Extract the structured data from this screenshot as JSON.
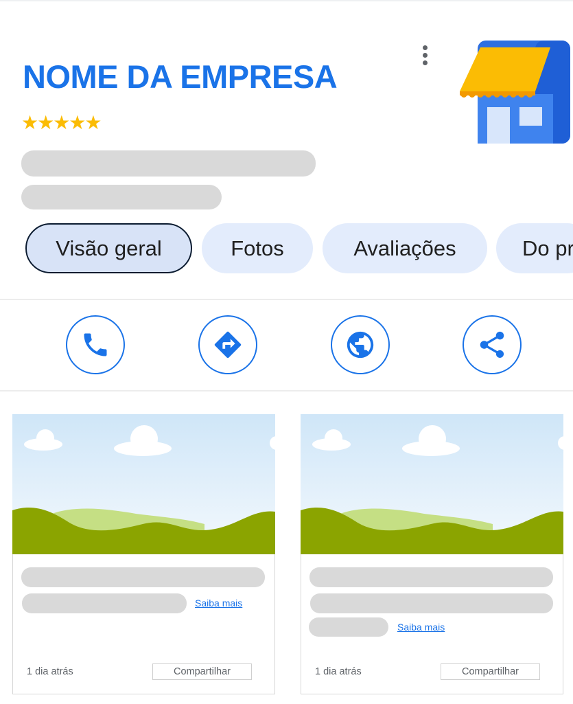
{
  "business": {
    "name": "NOME DA EMPRESA",
    "rating_stars": "★★★★★",
    "rating": 5
  },
  "tabs": [
    {
      "label": "Visão geral",
      "active": true
    },
    {
      "label": "Fotos"
    },
    {
      "label": "Avaliações"
    },
    {
      "label": "Do pr"
    }
  ],
  "actions": [
    {
      "icon": "phone-icon"
    },
    {
      "icon": "directions-icon"
    },
    {
      "icon": "website-icon"
    },
    {
      "icon": "share-icon"
    }
  ],
  "posts": [
    {
      "link_label": "Saiba mais",
      "time": "1 dia atrás",
      "share_label": "Compartilhar"
    },
    {
      "link_label": "Saiba mais",
      "time": "1 dia atrás",
      "share_label": "Compartilhar"
    }
  ],
  "colors": {
    "brand_blue": "#1a73e8",
    "star_yellow": "#fbbc04",
    "placeholder_gray": "#d9d9d9",
    "tab_bg": "#e3ecfc"
  }
}
